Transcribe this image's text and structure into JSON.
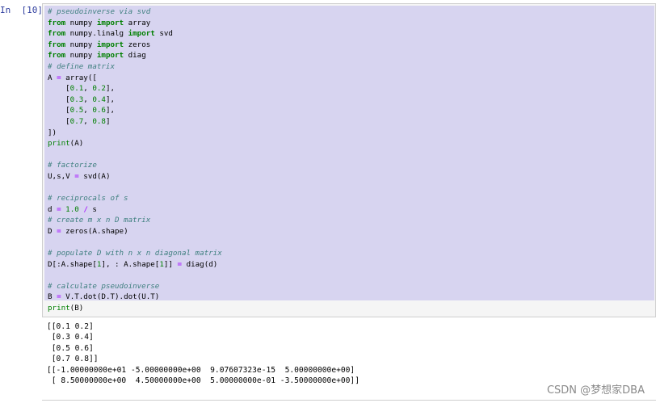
{
  "cell": {
    "prompt": "In  [10]:",
    "code_lines": [
      [
        {
          "t": "# pseudoinverse via svd",
          "c": "cm"
        }
      ],
      [
        {
          "t": "from",
          "c": "kw"
        },
        {
          "t": " numpy "
        },
        {
          "t": "import",
          "c": "kw"
        },
        {
          "t": " array"
        }
      ],
      [
        {
          "t": "from",
          "c": "kw"
        },
        {
          "t": " numpy.linalg "
        },
        {
          "t": "import",
          "c": "kw"
        },
        {
          "t": " svd"
        }
      ],
      [
        {
          "t": "from",
          "c": "kw"
        },
        {
          "t": " numpy "
        },
        {
          "t": "import",
          "c": "kw"
        },
        {
          "t": " zeros"
        }
      ],
      [
        {
          "t": "from",
          "c": "kw"
        },
        {
          "t": " numpy "
        },
        {
          "t": "import",
          "c": "kw"
        },
        {
          "t": " diag"
        }
      ],
      [
        {
          "t": "# define matrix",
          "c": "cm"
        }
      ],
      [
        {
          "t": "A "
        },
        {
          "t": "=",
          "c": "op"
        },
        {
          "t": " array(["
        }
      ],
      [
        {
          "t": "    ["
        },
        {
          "t": "0.1",
          "c": "nm"
        },
        {
          "t": ", "
        },
        {
          "t": "0.2",
          "c": "nm"
        },
        {
          "t": "],"
        }
      ],
      [
        {
          "t": "    ["
        },
        {
          "t": "0.3",
          "c": "nm"
        },
        {
          "t": ", "
        },
        {
          "t": "0.4",
          "c": "nm"
        },
        {
          "t": "],"
        }
      ],
      [
        {
          "t": "    ["
        },
        {
          "t": "0.5",
          "c": "nm"
        },
        {
          "t": ", "
        },
        {
          "t": "0.6",
          "c": "nm"
        },
        {
          "t": "],"
        }
      ],
      [
        {
          "t": "    ["
        },
        {
          "t": "0.7",
          "c": "nm"
        },
        {
          "t": ", "
        },
        {
          "t": "0.8",
          "c": "nm"
        },
        {
          "t": "]"
        }
      ],
      [
        {
          "t": "])"
        }
      ],
      [
        {
          "t": "print",
          "c": "bi"
        },
        {
          "t": "(A)"
        }
      ],
      [
        {
          "t": ""
        }
      ],
      [
        {
          "t": "# factorize",
          "c": "cm"
        }
      ],
      [
        {
          "t": "U,s,V "
        },
        {
          "t": "=",
          "c": "op"
        },
        {
          "t": " svd(A)"
        }
      ],
      [
        {
          "t": ""
        }
      ],
      [
        {
          "t": "# reciprocals of s",
          "c": "cm"
        }
      ],
      [
        {
          "t": "d "
        },
        {
          "t": "=",
          "c": "op"
        },
        {
          "t": " "
        },
        {
          "t": "1.0",
          "c": "nm"
        },
        {
          "t": " "
        },
        {
          "t": "/",
          "c": "op"
        },
        {
          "t": " s"
        }
      ],
      [
        {
          "t": "# create m x n D matrix",
          "c": "cm"
        }
      ],
      [
        {
          "t": "D "
        },
        {
          "t": "=",
          "c": "op"
        },
        {
          "t": " zeros(A.shape)"
        }
      ],
      [
        {
          "t": ""
        }
      ],
      [
        {
          "t": "# populate D with n x n diagonal matrix",
          "c": "cm"
        }
      ],
      [
        {
          "t": "D[:A.shape["
        },
        {
          "t": "1",
          "c": "nm"
        },
        {
          "t": "], : A.shape["
        },
        {
          "t": "1",
          "c": "nm"
        },
        {
          "t": "]] "
        },
        {
          "t": "=",
          "c": "op"
        },
        {
          "t": " diag(d)"
        }
      ],
      [
        {
          "t": ""
        }
      ],
      [
        {
          "t": "# calculate pseudoinverse",
          "c": "cm"
        }
      ],
      [
        {
          "t": "B "
        },
        {
          "t": "=",
          "c": "op"
        },
        {
          "t": " V.T.dot(D.T).dot(U.T)"
        }
      ],
      [
        {
          "t": "print",
          "c": "bi"
        },
        {
          "t": "(B)"
        }
      ]
    ],
    "output": "[[0.1 0.2]\n [0.3 0.4]\n [0.5 0.6]\n [0.7 0.8]]\n[[-1.00000000e+01 -5.00000000e+00  9.07607323e-15  5.00000000e+00]\n [ 8.50000000e+00  4.50000000e+00  5.00000000e-01 -3.50000000e+00]]"
  },
  "watermark": "CSDN @梦想家DBA"
}
